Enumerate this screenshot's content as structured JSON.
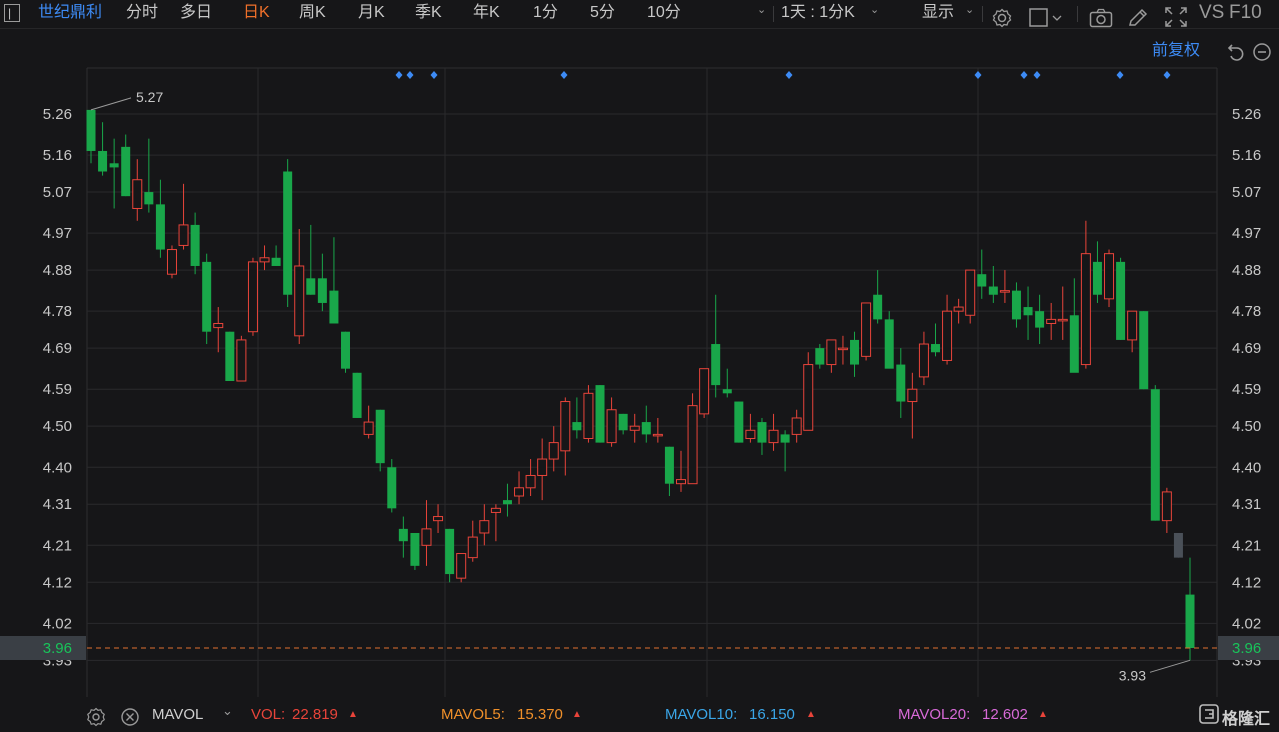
{
  "toolbar": {
    "stock_name": "世纪鼎利",
    "periods": [
      "分时",
      "多日",
      "日K",
      "周K",
      "月K",
      "季K",
      "年K",
      "1分",
      "5分",
      "10分"
    ],
    "active_period": "日K",
    "range_selector": "1天 : 1分K",
    "display_label": "显示",
    "vs_label": "VS",
    "f10_label": "F10"
  },
  "chart_header": {
    "adjust_label": "前复权"
  },
  "colors": {
    "up": "#e8443a",
    "down": "#19a74a",
    "blue_accent": "#3d8bf5",
    "active_tab": "#f0702a",
    "current_price_line": "#e07030",
    "grid": "#2a2a2c",
    "pending_bar": "#4a5058"
  },
  "y_axis_labels": [
    "5.26",
    "5.16",
    "5.07",
    "4.97",
    "4.88",
    "4.78",
    "4.69",
    "4.59",
    "4.50",
    "4.40",
    "4.31",
    "4.21",
    "4.12",
    "4.02",
    "3.93"
  ],
  "current_price": "3.96",
  "max_label": "5.27",
  "min_label": "3.93",
  "event_markers_count": 10,
  "chart_data": {
    "type": "candlestick",
    "ylim": [
      3.88,
      5.31
    ],
    "candles": [
      {
        "o": 5.27,
        "h": 5.27,
        "l": 5.14,
        "c": 5.17
      },
      {
        "o": 5.17,
        "h": 5.24,
        "l": 5.11,
        "c": 5.12
      },
      {
        "o": 5.14,
        "h": 5.2,
        "l": 5.03,
        "c": 5.13
      },
      {
        "o": 5.18,
        "h": 5.21,
        "l": 5.06,
        "c": 5.06
      },
      {
        "o": 5.03,
        "h": 5.15,
        "l": 5.0,
        "c": 5.1
      },
      {
        "o": 5.07,
        "h": 5.2,
        "l": 5.02,
        "c": 5.04
      },
      {
        "o": 5.04,
        "h": 5.1,
        "l": 4.91,
        "c": 4.93
      },
      {
        "o": 4.87,
        "h": 4.94,
        "l": 4.86,
        "c": 4.93
      },
      {
        "o": 4.94,
        "h": 5.09,
        "l": 4.93,
        "c": 4.99
      },
      {
        "o": 4.99,
        "h": 5.02,
        "l": 4.87,
        "c": 4.89
      },
      {
        "o": 4.9,
        "h": 4.92,
        "l": 4.7,
        "c": 4.73
      },
      {
        "o": 4.74,
        "h": 4.79,
        "l": 4.68,
        "c": 4.75
      },
      {
        "o": 4.73,
        "h": 4.73,
        "l": 4.61,
        "c": 4.61
      },
      {
        "o": 4.61,
        "h": 4.72,
        "l": 4.61,
        "c": 4.71
      },
      {
        "o": 4.73,
        "h": 4.91,
        "l": 4.72,
        "c": 4.9
      },
      {
        "o": 4.9,
        "h": 4.94,
        "l": 4.88,
        "c": 4.91
      },
      {
        "o": 4.91,
        "h": 4.94,
        "l": 4.89,
        "c": 4.89
      },
      {
        "o": 5.12,
        "h": 5.15,
        "l": 4.79,
        "c": 4.82
      },
      {
        "o": 4.72,
        "h": 4.98,
        "l": 4.7,
        "c": 4.89
      },
      {
        "o": 4.86,
        "h": 4.99,
        "l": 4.82,
        "c": 4.82
      },
      {
        "o": 4.86,
        "h": 4.92,
        "l": 4.78,
        "c": 4.8
      },
      {
        "o": 4.83,
        "h": 4.96,
        "l": 4.75,
        "c": 4.75
      },
      {
        "o": 4.73,
        "h": 4.73,
        "l": 4.63,
        "c": 4.64
      },
      {
        "o": 4.63,
        "h": 4.63,
        "l": 4.52,
        "c": 4.52
      },
      {
        "o": 4.48,
        "h": 4.55,
        "l": 4.47,
        "c": 4.51
      },
      {
        "o": 4.54,
        "h": 4.54,
        "l": 4.39,
        "c": 4.41
      },
      {
        "o": 4.4,
        "h": 4.42,
        "l": 4.29,
        "c": 4.3
      },
      {
        "o": 4.25,
        "h": 4.28,
        "l": 4.18,
        "c": 4.22
      },
      {
        "o": 4.24,
        "h": 4.24,
        "l": 4.15,
        "c": 4.16
      },
      {
        "o": 4.21,
        "h": 4.32,
        "l": 4.16,
        "c": 4.25
      },
      {
        "o": 4.27,
        "h": 4.31,
        "l": 4.24,
        "c": 4.28
      },
      {
        "o": 4.25,
        "h": 4.25,
        "l": 4.12,
        "c": 4.14
      },
      {
        "o": 4.13,
        "h": 4.19,
        "l": 4.12,
        "c": 4.19
      },
      {
        "o": 4.18,
        "h": 4.27,
        "l": 4.17,
        "c": 4.23
      },
      {
        "o": 4.24,
        "h": 4.31,
        "l": 4.21,
        "c": 4.27
      },
      {
        "o": 4.29,
        "h": 4.31,
        "l": 4.22,
        "c": 4.3
      },
      {
        "o": 4.32,
        "h": 4.36,
        "l": 4.28,
        "c": 4.31
      },
      {
        "o": 4.33,
        "h": 4.39,
        "l": 4.31,
        "c": 4.35
      },
      {
        "o": 4.35,
        "h": 4.42,
        "l": 4.33,
        "c": 4.38
      },
      {
        "o": 4.38,
        "h": 4.47,
        "l": 4.32,
        "c": 4.42
      },
      {
        "o": 4.42,
        "h": 4.5,
        "l": 4.39,
        "c": 4.46
      },
      {
        "o": 4.44,
        "h": 4.57,
        "l": 4.38,
        "c": 4.56
      },
      {
        "o": 4.51,
        "h": 4.57,
        "l": 4.47,
        "c": 4.49
      },
      {
        "o": 4.47,
        "h": 4.6,
        "l": 4.46,
        "c": 4.58
      },
      {
        "o": 4.6,
        "h": 4.6,
        "l": 4.46,
        "c": 4.46
      },
      {
        "o": 4.46,
        "h": 4.57,
        "l": 4.45,
        "c": 4.54
      },
      {
        "o": 4.53,
        "h": 4.53,
        "l": 4.48,
        "c": 4.49
      },
      {
        "o": 4.49,
        "h": 4.53,
        "l": 4.46,
        "c": 4.5
      },
      {
        "o": 4.51,
        "h": 4.55,
        "l": 4.46,
        "c": 4.48
      },
      {
        "o": 4.48,
        "h": 4.52,
        "l": 4.46,
        "c": 4.48
      },
      {
        "o": 4.45,
        "h": 4.45,
        "l": 4.33,
        "c": 4.36
      },
      {
        "o": 4.36,
        "h": 4.44,
        "l": 4.34,
        "c": 4.37
      },
      {
        "o": 4.36,
        "h": 4.58,
        "l": 4.36,
        "c": 4.55
      },
      {
        "o": 4.53,
        "h": 4.64,
        "l": 4.52,
        "c": 4.64
      },
      {
        "o": 4.7,
        "h": 4.82,
        "l": 4.57,
        "c": 4.6
      },
      {
        "o": 4.59,
        "h": 4.64,
        "l": 4.57,
        "c": 4.58
      },
      {
        "o": 4.56,
        "h": 4.56,
        "l": 4.46,
        "c": 4.46
      },
      {
        "o": 4.47,
        "h": 4.53,
        "l": 4.46,
        "c": 4.49
      },
      {
        "o": 4.51,
        "h": 4.52,
        "l": 4.43,
        "c": 4.46
      },
      {
        "o": 4.46,
        "h": 4.53,
        "l": 4.44,
        "c": 4.49
      },
      {
        "o": 4.48,
        "h": 4.49,
        "l": 4.39,
        "c": 4.46
      },
      {
        "o": 4.48,
        "h": 4.54,
        "l": 4.46,
        "c": 4.52
      },
      {
        "o": 4.49,
        "h": 4.68,
        "l": 4.49,
        "c": 4.65
      },
      {
        "o": 4.69,
        "h": 4.7,
        "l": 4.64,
        "c": 4.65
      },
      {
        "o": 4.65,
        "h": 4.71,
        "l": 4.63,
        "c": 4.71
      },
      {
        "o": 4.69,
        "h": 4.72,
        "l": 4.65,
        "c": 4.69
      },
      {
        "o": 4.71,
        "h": 4.73,
        "l": 4.62,
        "c": 4.65
      },
      {
        "o": 4.67,
        "h": 4.8,
        "l": 4.66,
        "c": 4.8
      },
      {
        "o": 4.82,
        "h": 4.88,
        "l": 4.75,
        "c": 4.76
      },
      {
        "o": 4.76,
        "h": 4.78,
        "l": 4.65,
        "c": 4.64
      },
      {
        "o": 4.65,
        "h": 4.69,
        "l": 4.52,
        "c": 4.56
      },
      {
        "o": 4.56,
        "h": 4.63,
        "l": 4.47,
        "c": 4.59
      },
      {
        "o": 4.62,
        "h": 4.73,
        "l": 4.6,
        "c": 4.7
      },
      {
        "o": 4.7,
        "h": 4.75,
        "l": 4.67,
        "c": 4.68
      },
      {
        "o": 4.66,
        "h": 4.82,
        "l": 4.65,
        "c": 4.78
      },
      {
        "o": 4.78,
        "h": 4.81,
        "l": 4.75,
        "c": 4.79
      },
      {
        "o": 4.77,
        "h": 4.88,
        "l": 4.75,
        "c": 4.88
      },
      {
        "o": 4.87,
        "h": 4.93,
        "l": 4.81,
        "c": 4.84
      },
      {
        "o": 4.84,
        "h": 4.89,
        "l": 4.8,
        "c": 4.82
      },
      {
        "o": 4.83,
        "h": 4.88,
        "l": 4.8,
        "c": 4.83
      },
      {
        "o": 4.83,
        "h": 4.85,
        "l": 4.74,
        "c": 4.76
      },
      {
        "o": 4.79,
        "h": 4.84,
        "l": 4.71,
        "c": 4.77
      },
      {
        "o": 4.78,
        "h": 4.82,
        "l": 4.7,
        "c": 4.74
      },
      {
        "o": 4.75,
        "h": 4.8,
        "l": 4.71,
        "c": 4.76
      },
      {
        "o": 4.76,
        "h": 4.84,
        "l": 4.71,
        "c": 4.76
      },
      {
        "o": 4.77,
        "h": 4.86,
        "l": 4.72,
        "c": 4.63
      },
      {
        "o": 4.65,
        "h": 5.0,
        "l": 4.64,
        "c": 4.92
      },
      {
        "o": 4.9,
        "h": 4.95,
        "l": 4.8,
        "c": 4.82
      },
      {
        "o": 4.81,
        "h": 4.93,
        "l": 4.79,
        "c": 4.92
      },
      {
        "o": 4.9,
        "h": 4.91,
        "l": 4.71,
        "c": 4.71
      },
      {
        "o": 4.71,
        "h": 4.77,
        "l": 4.68,
        "c": 4.78
      },
      {
        "o": 4.78,
        "h": 4.78,
        "l": 4.59,
        "c": 4.59
      },
      {
        "o": 4.59,
        "h": 4.6,
        "l": 4.27,
        "c": 4.27
      },
      {
        "o": 4.27,
        "h": 4.35,
        "l": 4.24,
        "c": 4.34
      },
      {
        "o": 4.24,
        "h": 4.24,
        "l": 4.18,
        "c": 4.18
      },
      {
        "o": 4.09,
        "h": 4.18,
        "l": 3.93,
        "c": 3.96
      }
    ],
    "pending_index": 94
  },
  "volume_bar": {
    "indicator": "MAVOL",
    "vol_label": "VOL:",
    "vol_value": "22.819",
    "mavol5_label": "MAVOL5:",
    "mavol5_value": "15.370",
    "mavol10_label": "MAVOL10:",
    "mavol10_value": "16.150",
    "mavol20_label": "MAVOL20:",
    "mavol20_value": "12.602"
  },
  "brand": {
    "name": "格隆汇"
  }
}
